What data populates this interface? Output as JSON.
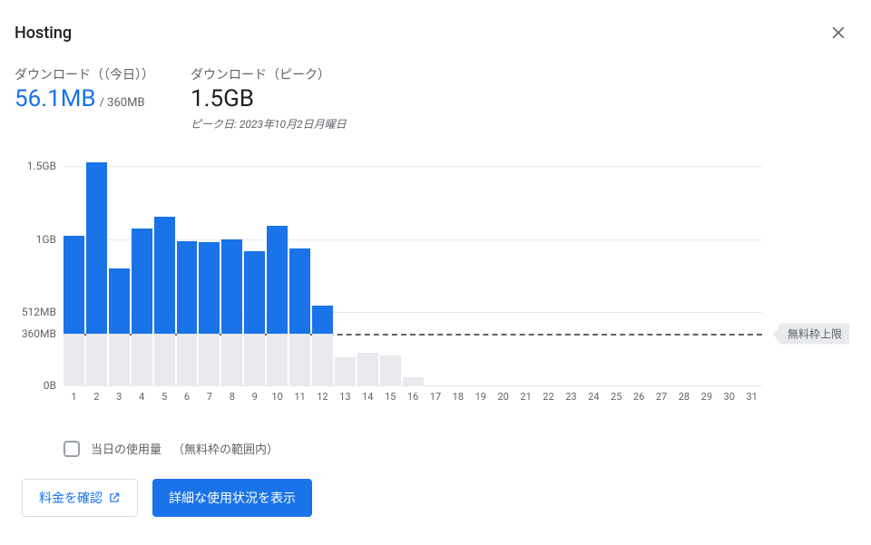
{
  "header": {
    "title": "Hosting"
  },
  "metrics": {
    "today": {
      "label": "ダウンロード（（今日））",
      "value": "56.1MB",
      "limit": "/ 360MB"
    },
    "peak": {
      "label": "ダウンロード（ピーク）",
      "value": "1.5GB",
      "peak_date": "ピーク日: 2023年10月2日月曜日"
    }
  },
  "chart_data": {
    "type": "bar",
    "categories": [
      "1",
      "2",
      "3",
      "4",
      "5",
      "6",
      "7",
      "8",
      "9",
      "10",
      "11",
      "12",
      "13",
      "14",
      "15",
      "16",
      "17",
      "18",
      "19",
      "20",
      "21",
      "22",
      "23",
      "24",
      "25",
      "26",
      "27",
      "28",
      "29",
      "30",
      "31"
    ],
    "values_mb": [
      1050,
      1560,
      820,
      1100,
      1180,
      1010,
      1000,
      1020,
      940,
      1120,
      960,
      560,
      200,
      230,
      210,
      60,
      0,
      0,
      0,
      0,
      0,
      0,
      0,
      0,
      0,
      0,
      0,
      0,
      0,
      0,
      0
    ],
    "free_tier_mb": 360,
    "y_ticks": [
      {
        "label": "1.5GB",
        "value_mb": 1536
      },
      {
        "label": "1GB",
        "value_mb": 1024
      },
      {
        "label": "512MB",
        "value_mb": 512
      },
      {
        "label": "360MB",
        "value_mb": 360
      },
      {
        "label": "0B",
        "value_mb": 0
      }
    ],
    "y_max_mb": 1650,
    "xlabel": "",
    "ylabel": "",
    "title": ""
  },
  "free_tier_tag": "無料枠上限",
  "legend": {
    "today_usage": "当日の使用量",
    "within_free": "（無料枠の範囲内）"
  },
  "actions": {
    "pricing": "料金を確認",
    "details": "詳細な使用状況を表示"
  }
}
